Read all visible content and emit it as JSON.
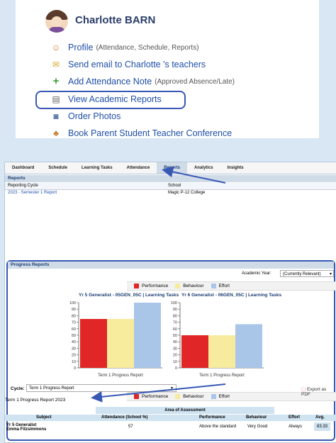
{
  "profile": {
    "student_name": "Charlotte BARN",
    "links": [
      {
        "label": "Profile",
        "note": "(Attendance, Schedule, Reports)",
        "icon": "profile-icon",
        "glyph": "☺",
        "color": "#d07a2a"
      },
      {
        "label": "Send email to Charlotte 's teachers",
        "note": "",
        "icon": "email-icon",
        "glyph": "✉",
        "color": "#d9a52a"
      },
      {
        "label": "Add Attendance Note",
        "note": "(Approved Absence/Late)",
        "icon": "plus-icon",
        "glyph": "+",
        "color": "#3a9a3a"
      },
      {
        "label": "View Academic Reports",
        "note": "",
        "icon": "report-icon",
        "glyph": "▤",
        "color": "#666"
      },
      {
        "label": "Order Photos",
        "note": "",
        "icon": "camera-icon",
        "glyph": "◙",
        "color": "#4a6aa0"
      },
      {
        "label": "Book Parent Student Teacher Conference",
        "note": "",
        "icon": "conference-icon",
        "glyph": "♣",
        "color": "#c07a2a"
      }
    ]
  },
  "tabs": [
    "Dashboard",
    "Schedule",
    "Learning Tasks",
    "Attendance",
    "Reports",
    "Analytics",
    "Insights"
  ],
  "active_tab": "Reports",
  "reports": {
    "heading": "Reports",
    "col_cycle": "Reporting Cycle",
    "col_school": "School",
    "rows": [
      {
        "cycle": "2023 - Semester 1 Report",
        "school": "Magic P-12 College"
      }
    ]
  },
  "progress": {
    "heading": "Progress Reports",
    "academic_year_label": "Academic Year:",
    "academic_year_value": "(Currently Relevant)",
    "legend": [
      "Performance",
      "Behaviour",
      "Effort"
    ],
    "cycle_label": "Cycle:",
    "cycle_value": "Term 1 Progress Report",
    "export_label": "Export as PDF",
    "report_title": "Term 1 Progress Report 2023",
    "area_heading": "Area of Assessment",
    "table_headers": [
      "Subject",
      "Attendance (School %)",
      "Performance",
      "Behaviour",
      "Effort",
      "Avg."
    ],
    "row": {
      "subject": "Yr 5 Generalist",
      "teacher": "Emma Fitzsimmons",
      "attendance": "57",
      "performance": "Above the standard",
      "behaviour": "Very Good",
      "effort": "Always",
      "avg": "83.33"
    }
  },
  "chart_data": [
    {
      "type": "bar",
      "title": "Yr 5 Generalist - 05GEN_05C | Learning Tasks",
      "categories": [
        "Term 1 Progress Report"
      ],
      "series": [
        {
          "name": "Performance",
          "values": [
            75
          ],
          "color": "#e02626"
        },
        {
          "name": "Behaviour",
          "values": [
            75
          ],
          "color": "#f7ec9e"
        },
        {
          "name": "Effort",
          "values": [
            100
          ],
          "color": "#a9c6e8"
        }
      ],
      "ylim": [
        0,
        100
      ],
      "yticks": [
        0,
        10,
        20,
        30,
        40,
        50,
        60,
        70,
        80,
        90,
        100
      ]
    },
    {
      "type": "bar",
      "title": "Yr 6 Generalist - 06GEN_05C | Learning Tasks",
      "categories": [
        "Term 1 Progress Report"
      ],
      "series": [
        {
          "name": "Performance",
          "values": [
            50
          ],
          "color": "#e02626"
        },
        {
          "name": "Behaviour",
          "values": [
            50
          ],
          "color": "#f7ec9e"
        },
        {
          "name": "Effort",
          "values": [
            67
          ],
          "color": "#a9c6e8"
        }
      ],
      "ylim": [
        0,
        100
      ],
      "yticks": [
        0,
        10,
        20,
        30,
        40,
        50,
        60,
        70,
        80,
        90,
        100
      ]
    }
  ]
}
